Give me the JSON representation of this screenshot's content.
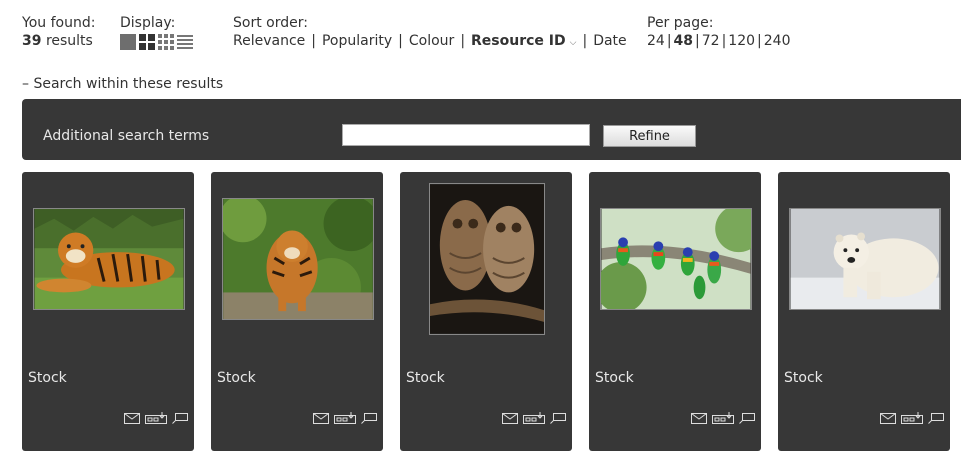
{
  "results": {
    "found_label": "You found:",
    "count": "39",
    "suffix": "results"
  },
  "display": {
    "label": "Display:",
    "icons": [
      "large-thumbs-icon",
      "small-thumbs-icon",
      "xsmall-thumbs-icon",
      "list-view-icon"
    ]
  },
  "sort": {
    "label": "Sort order:",
    "options": [
      "Relevance",
      "Popularity",
      "Colour",
      "Resource ID",
      "Date"
    ],
    "active": "Resource ID",
    "direction_icon": "caret-down-icon"
  },
  "perpage": {
    "label": "Per page:",
    "options": [
      "24",
      "48",
      "72",
      "120",
      "240"
    ],
    "active": "48"
  },
  "search_within": {
    "toggle_label": "– Search within these results",
    "field_label": "Additional search terms",
    "value": "",
    "button_label": "Refine"
  },
  "resources": [
    {
      "title": "Stock",
      "image": "tiger lying on grass"
    },
    {
      "title": "Stock",
      "image": "tiger walking through foliage"
    },
    {
      "title": "Stock",
      "image": "two owls on a branch"
    },
    {
      "title": "Stock",
      "image": "lorikeets on a branch"
    },
    {
      "title": "Stock",
      "image": "polar bear in snow"
    }
  ],
  "card_tools": [
    "email-icon",
    "add-to-collection-icon",
    "comment-icon"
  ],
  "colors": {
    "panel_bg": "#373737",
    "text": "#333333",
    "panel_text": "#e8e8e8"
  }
}
